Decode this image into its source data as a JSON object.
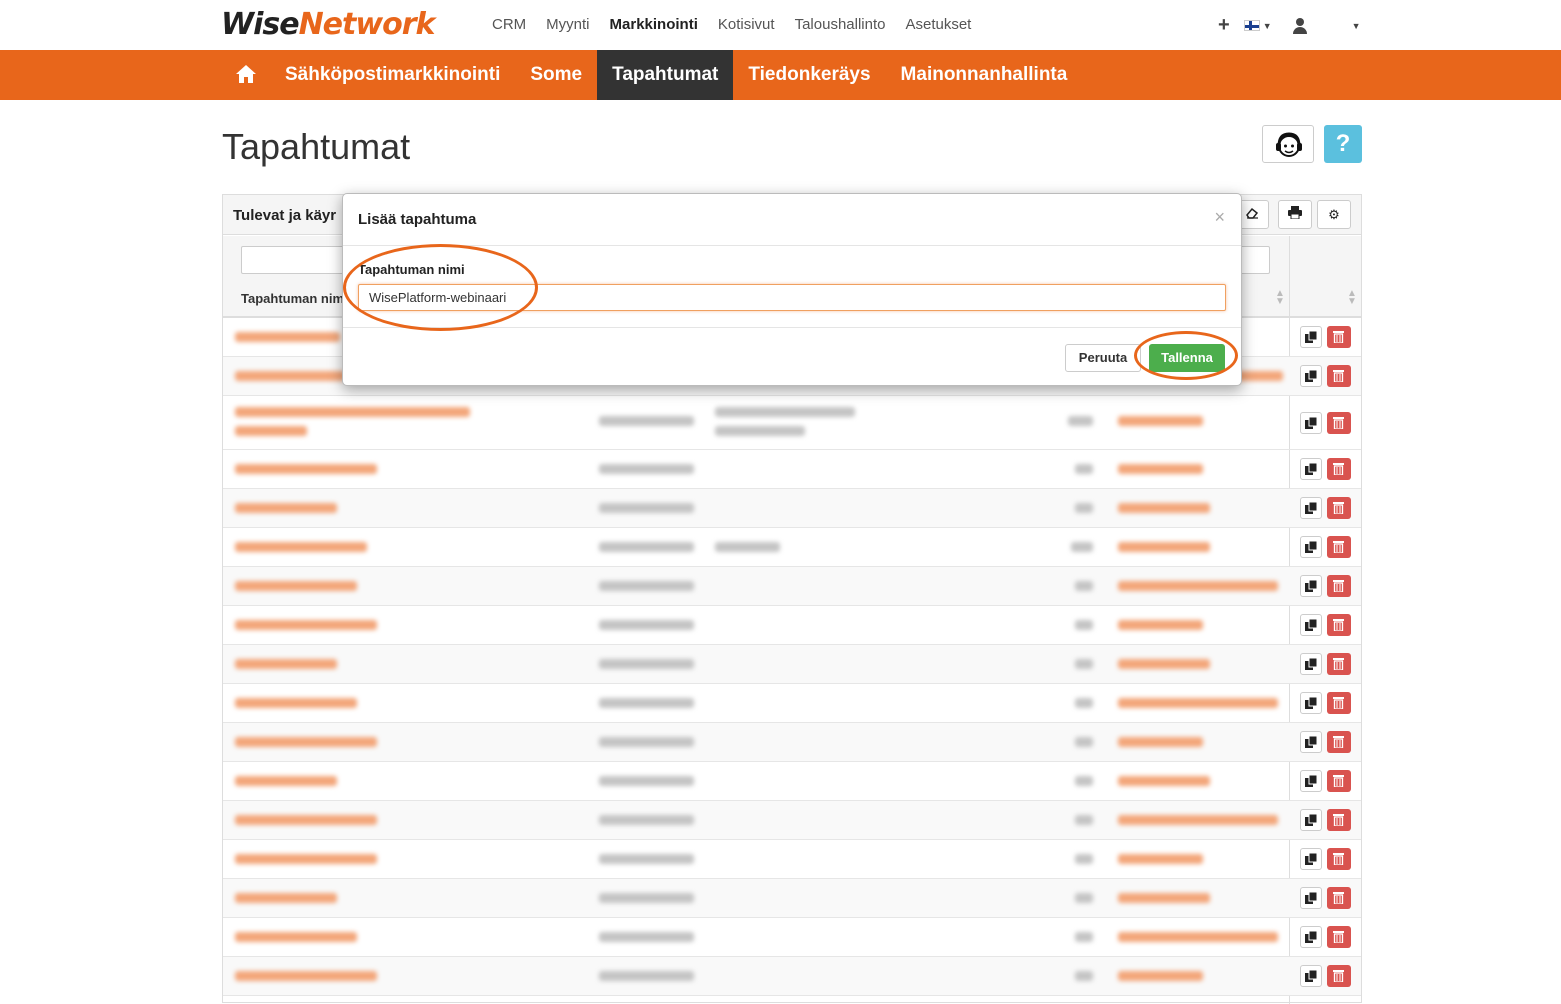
{
  "logo": {
    "part1": "Wise",
    "part2": "Network"
  },
  "top_nav": [
    "CRM",
    "Myynti",
    "Markkinointi",
    "Kotisivut",
    "Taloushallinto",
    "Asetukset"
  ],
  "top_right": {
    "add_icon": "plus-icon",
    "language": "fi",
    "user_icon": "user-icon"
  },
  "main_nav": {
    "home_icon": "home-icon",
    "items": [
      "Sähköpostimarkkinointi",
      "Some",
      "Tapahtumat",
      "Tiedonkeräys",
      "Mainonnanhallinta"
    ],
    "active": "Tapahtumat"
  },
  "page": {
    "title": "Tapahtumat"
  },
  "panel": {
    "title": "Tulevat ja käyr",
    "column_name_label": "Tapahtuman nim"
  },
  "modal": {
    "title": "Lisää tapahtuma",
    "close_label": "×",
    "field_label": "Tapahtuman nimi",
    "field_value": "WisePlatform-webinaari",
    "cancel_label": "Peruuta",
    "save_label": "Tallenna"
  },
  "colors": {
    "brand_orange": "#e8661b",
    "save_green": "#4cae4c",
    "delete_red": "#d9534f",
    "help_blue": "#5bc0de"
  }
}
